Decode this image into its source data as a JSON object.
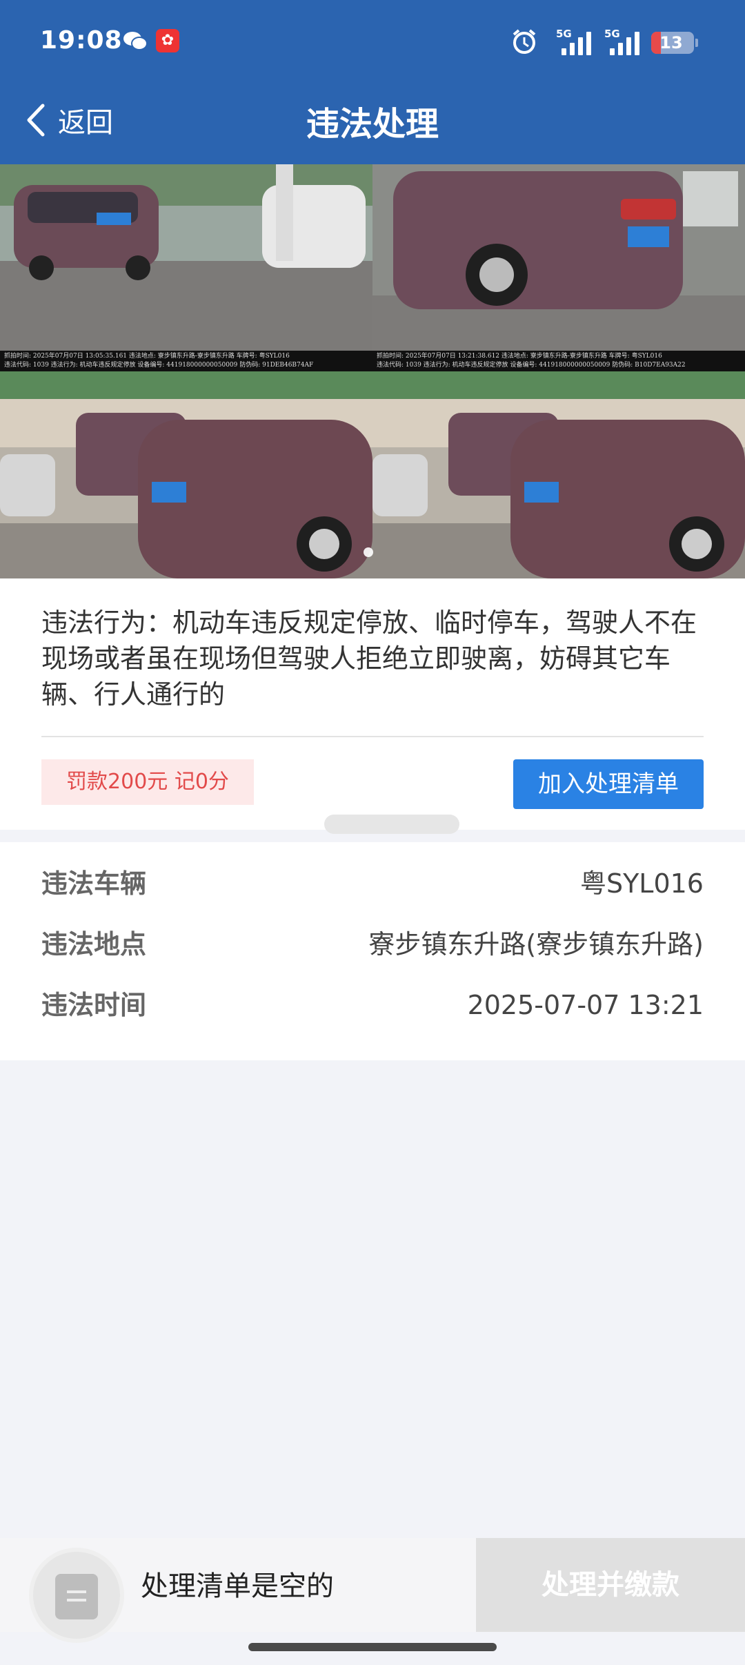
{
  "status_bar": {
    "time": "19:08",
    "signal1_label": "5G",
    "signal2_label": "5G",
    "battery": "13"
  },
  "header": {
    "back_label": "返回",
    "title": "违法处理"
  },
  "photos": [
    {
      "caption_line1": "抓拍时间: 2025年07月07日 13:05:35.161 违法地点: 寮步镇东升路-寮步镇东升路 车牌号: 粤SYL016",
      "caption_line2": "违法代码: 1039 违法行为: 机动车违反规定停放 设备编号: 441918000000050009 防伪码: 91DEB46B74AF"
    },
    {
      "caption_line1": "抓拍时间: 2025年07月07日 13:21:38.612 违法地点: 寮步镇东升路-寮步镇东升路 车牌号: 粤SYL016",
      "caption_line2": "违法代码: 1039 违法行为: 机动车违反规定停放 设备编号: 441918000000050009 防伪码: B10D7EA93A22"
    }
  ],
  "violation": {
    "text": "违法行为：机动车违反规定停放、临时停车，驾驶人不在现场或者虽在现场但驾驶人拒绝立即驶离，妨碍其它车辆、行人通行的",
    "fine_label": "罚款200元 记0分",
    "add_button": "加入处理清单"
  },
  "details": [
    {
      "label": "违法车辆",
      "value": "粤SYL016"
    },
    {
      "label": "违法地点",
      "value": "寮步镇东升路(寮步镇东升路)"
    },
    {
      "label": "违法时间",
      "value": "2025-07-07 13:21"
    }
  ],
  "bottom": {
    "empty_text": "处理清单是空的",
    "pay_button": "处理并缴款"
  },
  "colors": {
    "header_bg": "#2b64b0",
    "primary_button": "#2a82e4",
    "fine_bg": "#fde9e9",
    "fine_text": "#e24a4a"
  }
}
